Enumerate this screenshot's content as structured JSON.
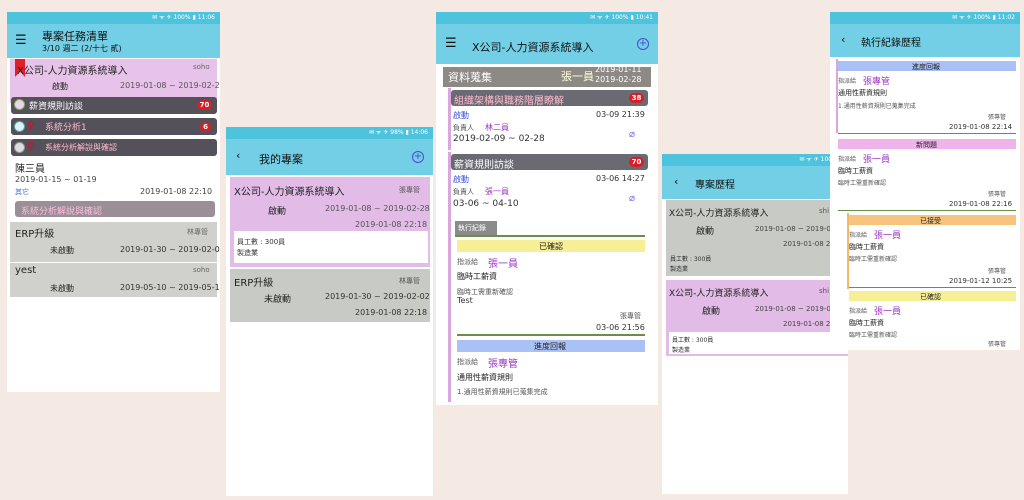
{
  "p1": {
    "status": "✉ ᯤ ✈ 100% ▮ 11:06",
    "title": "專案任務清單",
    "subtitle": "3/10 週二 (2/十七 貳)",
    "project1": {
      "name": "X公司-人力資源系統導入",
      "owner": "soho",
      "status": "啟動",
      "dates": "2019-01-08 ~ 2019-02-28"
    },
    "tasks": [
      {
        "label": "薪資規則訪談",
        "badge": "70"
      },
      {
        "label": "系統分析1",
        "badge": "6"
      },
      {
        "label": "系統分析解說與確認",
        "badge": ""
      }
    ],
    "person": "陳三員",
    "person_dates": "2019-01-15 ~ 01-19",
    "other": "其它",
    "other_date": "2019-01-08 22:10",
    "task4": "系統分析解說與確認",
    "project2": {
      "name": "ERP升級",
      "owner": "林專管",
      "status": "未啟動",
      "dates": "2019-01-30 ~ 2019-02-02"
    },
    "project3": {
      "name": "yest",
      "owner": "soho",
      "status": "未啟動",
      "dates": "2019-05-10 ~ 2019-05-10"
    }
  },
  "p2": {
    "status": "✉ ᯤ ✈ 98% ▮ 14:06",
    "title": "我的專案",
    "card1": {
      "name": "X公司-人力資源系統導入",
      "owner": "張專管",
      "status": "啟動",
      "dates": "2019-01-08 ~ 2019-02-28",
      "updated": "2019-01-08 22:18",
      "staff": "員工數 : 300員",
      "industry": "製造業"
    },
    "card2": {
      "name": "ERP升級",
      "owner": "林專管",
      "status": "未啟動",
      "dates": "2019-01-30 ~ 2019-02-02",
      "updated": "2019-01-08 22:18"
    }
  },
  "p3": {
    "status": "✉ ᯤ ✈ 100% ▮ 10:41",
    "title": "X公司-人力資源系統導入",
    "section": "資料蒐集",
    "sec_person": "張一員",
    "sec_start": "2019-01-11",
    "sec_end": "2019-02-28",
    "task1": {
      "name": "組織架構與職務階層瞭解",
      "badge": "38",
      "status": "啟動",
      "time": "03-09 21:39",
      "owner_label": "負責人",
      "owner": "林二員",
      "dates": "2019-02-09 ~ 02-28"
    },
    "task2": {
      "name": "薪資規則訪談",
      "badge": "70",
      "status": "啟動",
      "time": "03-06 14:27",
      "owner_label": "負責人",
      "owner": "張一員",
      "dates": "03-06 ~ 04-10"
    },
    "log_tab": "執行紀錄",
    "log1": {
      "state": "已確認",
      "assign": "指派給",
      "assignee": "張一員",
      "item": "臨時工薪資",
      "note": "臨時工需重新確認",
      "extra": "Test",
      "by": "張專管",
      "time": "03-06 21:56"
    },
    "log2": {
      "state": "進度回報",
      "assign": "指派給",
      "assignee": "張專管",
      "item": "通用性薪資規則",
      "note": "1.通用性薪資規則已蒐集完成"
    }
  },
  "p4": {
    "status": "✉ ᯤ ✈ 100% ▮",
    "title": "專案歷程",
    "card1": {
      "name": "X公司-人力資源系統導入",
      "owner": "shi",
      "status": "啟動",
      "dates": "2019-01-08 ~ 2019-0",
      "updated": "2019-01-08 2",
      "staff": "員工數 : 300員",
      "industry": "製造業"
    },
    "card2": {
      "name": "X公司-人力資源系統導入",
      "owner": "shi",
      "status": "啟動",
      "dates": "2019-01-08 ~ 2019-0",
      "updated": "2019-01-08 2",
      "staff": "員工數 : 300員",
      "industry": "製造業"
    }
  },
  "p5": {
    "status": "✉ ᯤ ✈ 100% ▮ 11:02",
    "title": "執行紀錄歷程",
    "logs": [
      {
        "state": "進度回報",
        "assign": "指派給",
        "assignee": "張專管",
        "item": "通用性薪資規則",
        "note": "1.通用性薪資規則已蒐集完成",
        "by": "張專管",
        "time": "2019-01-08 22:14"
      },
      {
        "state": "新問題",
        "assign": "指派給",
        "assignee": "張一員",
        "item": "臨時工薪資",
        "note": "臨時工需重新確認",
        "by": "張專管",
        "time": "2019-01-08 22:16"
      },
      {
        "state": "已接受",
        "assign": "指派給",
        "assignee": "張一員",
        "item": "臨時工薪資",
        "note": "臨時工需重新確認",
        "by": "張專管",
        "time": "2019-01-12 10:25"
      },
      {
        "state": "已確認",
        "assign": "指派給",
        "assignee": "張一員",
        "item": "臨時工薪資",
        "note": "臨時工需重新確認",
        "by": "張專管",
        "time": ""
      }
    ]
  }
}
